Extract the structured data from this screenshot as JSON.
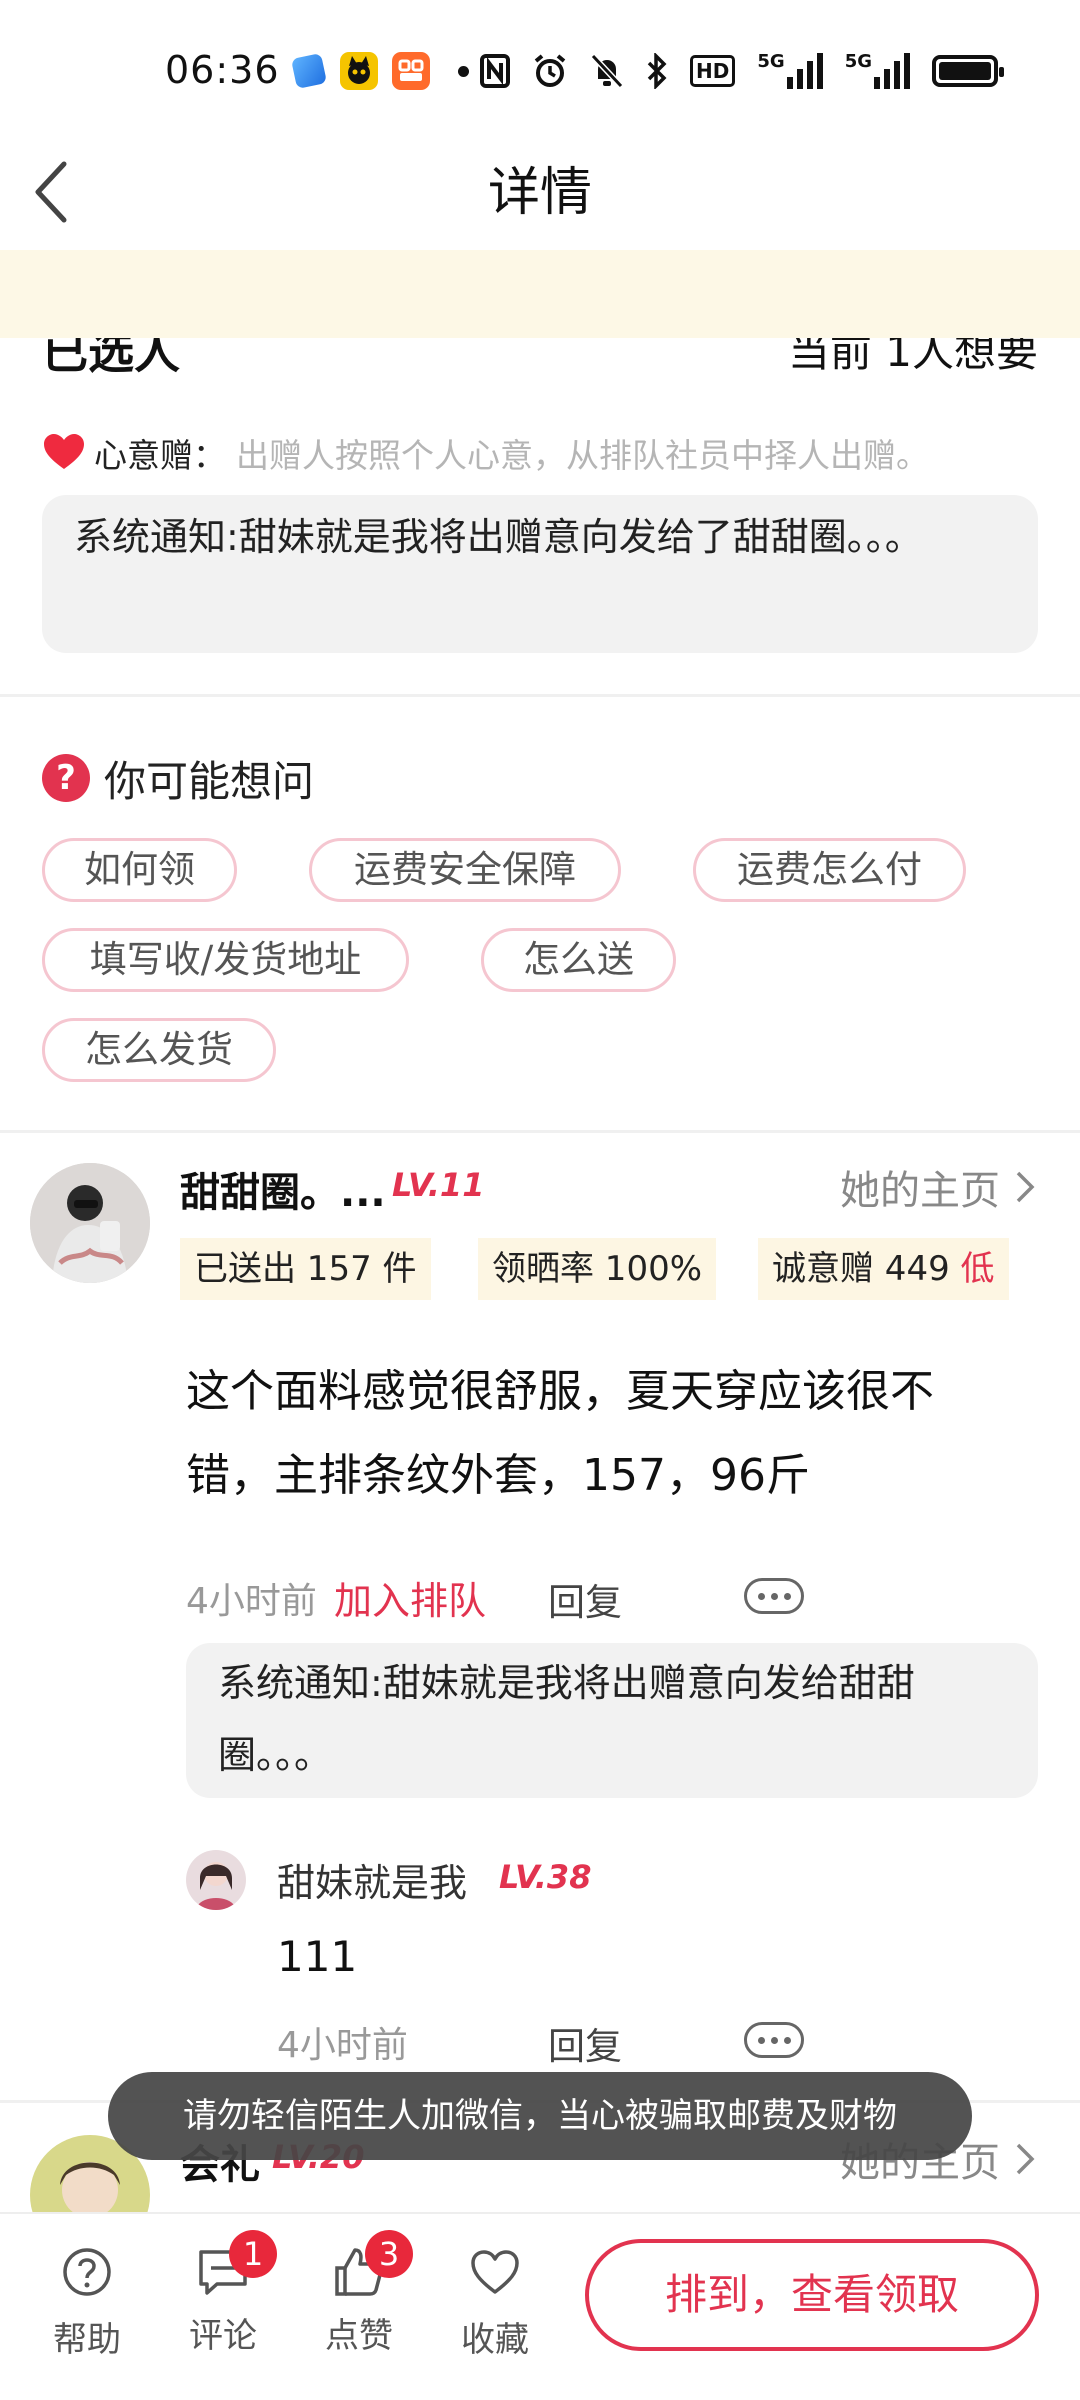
{
  "status_bar": {
    "time": "06:36",
    "network_1": "5G",
    "network_2": "5G",
    "hd_label": "HD",
    "app_icons": [
      "blue-app-icon",
      "cat-app-icon",
      "orange-app-icon"
    ],
    "icons": [
      "nfc-icon",
      "alarm-icon",
      "mute-icon",
      "bluetooth-icon",
      "hd-icon",
      "signal-icon",
      "signal-icon",
      "battery-icon"
    ]
  },
  "nav": {
    "title": "详情",
    "back_icon": "back-arrow-icon"
  },
  "selected": {
    "title": "已选人",
    "wanted": "当前 1人想要"
  },
  "intent": {
    "label": "心意赠：",
    "desc": "出赠人按照个人心意，从排队社员中择人出赠。",
    "icon": "heart-icon"
  },
  "system_notice_1": "系统通知:甜妹就是我将出赠意向发给了甜甜圈。。。",
  "faq": {
    "title": "你可能想问",
    "chips": [
      "如何领",
      "运费安全保障",
      "运费怎么付",
      "填写收/发货地址",
      "怎么送",
      "怎么发货"
    ]
  },
  "comment": {
    "user": "甜甜圈。...",
    "level": "LV.11",
    "home_link": "她的主页",
    "stats": {
      "sent": "已送出 157 件",
      "show_rate": "领晒率 100%",
      "sincerity": "诚意赠 449",
      "sincerity_level": "低"
    },
    "text": "这个面料感觉很舒服，夏天穿应该很不错，主排条纹外套，157，96斤",
    "time": "4小时前",
    "join_queue": "加入排队",
    "reply": "回复",
    "system_notice": "系统通知:甜妹就是我将出赠意向发给甜甜圈。。。",
    "sub_reply": {
      "user": "甜妹就是我",
      "level": "LV.38",
      "text": "111",
      "time": "4小时前",
      "reply": "回复"
    }
  },
  "next_comment": {
    "user": "会礼",
    "level": "LV.20",
    "home_link": "她的主页"
  },
  "toast": "请勿轻信陌生人加微信，当心被骗取邮费及财物",
  "bottom_bar": {
    "tabs": [
      {
        "label": "帮助",
        "icon": "help-icon",
        "badge": ""
      },
      {
        "label": "评论",
        "icon": "comment-icon",
        "badge": "1"
      },
      {
        "label": "点赞",
        "icon": "like-icon",
        "badge": "3"
      },
      {
        "label": "收藏",
        "icon": "favorite-icon",
        "badge": ""
      }
    ],
    "cta": "排到，查看领取"
  },
  "colors": {
    "accent": "#e2334f",
    "notice_band": "#fdf8e6",
    "stat_bg": "#fdf6e3",
    "chip_border": "#f5c6d0"
  }
}
